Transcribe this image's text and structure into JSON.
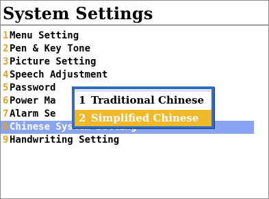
{
  "title": "System Settings",
  "menu": {
    "items": [
      {
        "num": "1",
        "label": "Menu Setting"
      },
      {
        "num": "2",
        "label": "Pen & Key Tone"
      },
      {
        "num": "3",
        "label": "Picture Setting"
      },
      {
        "num": "4",
        "label": "Speech Adjustment"
      },
      {
        "num": "5",
        "label": "Password"
      },
      {
        "num": "6",
        "label": "Power Ma"
      },
      {
        "num": "7",
        "label": "Alarm Se"
      },
      {
        "num": "8",
        "label": "Chinese System Setting"
      },
      {
        "num": "9",
        "label": "Handwriting Setting"
      }
    ],
    "selected_index": 7
  },
  "popup": {
    "options": [
      {
        "num": "1",
        "label": "Traditional Chinese"
      },
      {
        "num": "2",
        "label": "Simplified Chinese"
      }
    ],
    "selected_index": 1
  },
  "colors": {
    "number_accent": "#e8a020",
    "menu_highlight": "#8aa4f4",
    "popup_border": "#2f6cc4",
    "popup_highlight": "#f0b92a"
  }
}
